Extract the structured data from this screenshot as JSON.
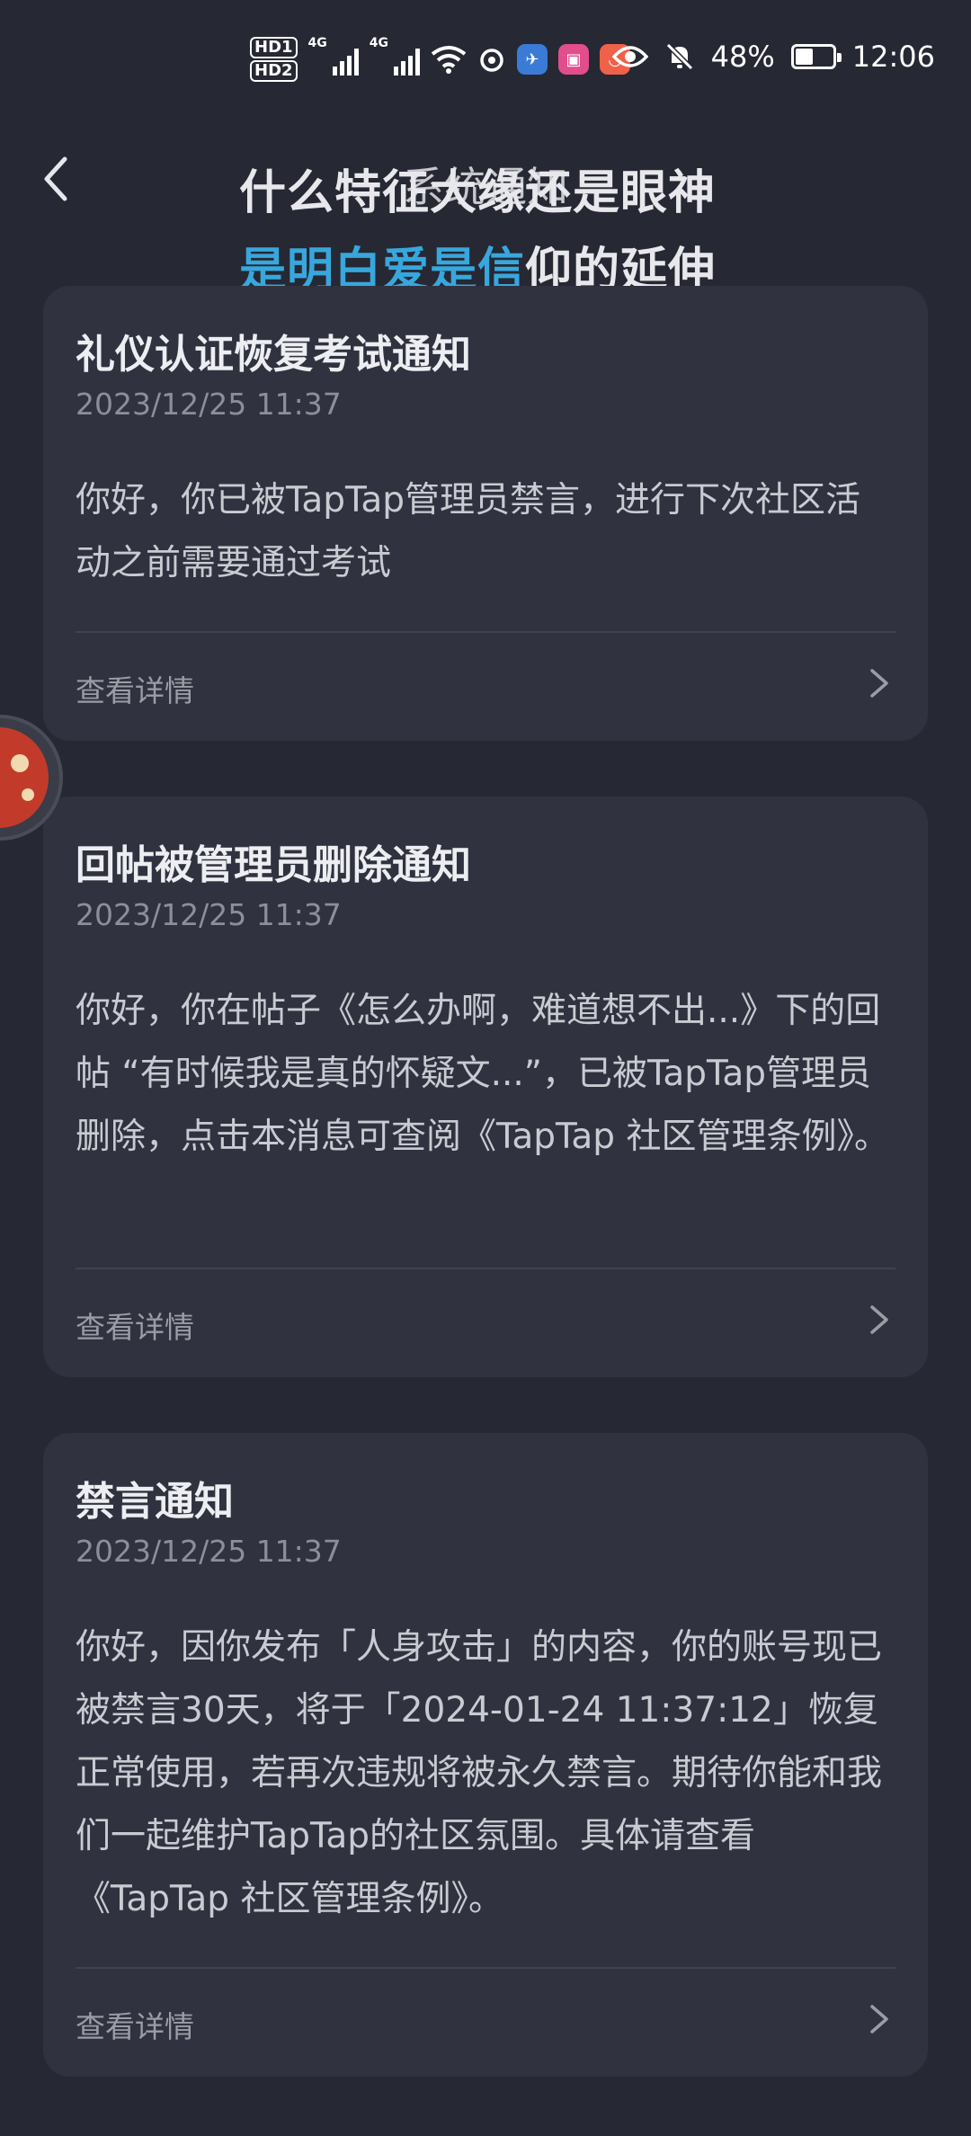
{
  "status_bar": {
    "hd1": "HD1",
    "hd2": "HD2",
    "net1": "4G",
    "net2": "4G",
    "battery": "48%",
    "time": "12:06",
    "battery_level": 0.48
  },
  "header": {
    "title": "系统通知",
    "lyric_line1": "什么特征大缘还是眼神",
    "lyric_line2_highlight": "是明白爱是信",
    "lyric_line2_rest": "仰的延伸"
  },
  "cards": [
    {
      "title": "礼仪认证恢复考试通知",
      "date": "2023/12/25 11:37",
      "body": "你好，你已被TapTap管理员禁言，进行下次社区活动之前需要通过考试",
      "detail": "查看详情"
    },
    {
      "title": "回帖被管理员删除通知",
      "date": "2023/12/25 11:37",
      "body": "你好，你在帖子《怎么办啊，难道想不出...》下的回帖 “有时候我是真的怀疑文...”，已被TapTap管理员删除，点击本消息可查阅《TapTap 社区管理条例》。",
      "detail": "查看详情"
    },
    {
      "title": "禁言通知",
      "date": "2023/12/25 11:37",
      "body": "你好，因你发布「人身攻击」的内容，你的账号现已被禁言30天，将于「2024-01-24 11:37:12」恢复正常使用，若再次违规将被永久禁言。期待你能和我们一起维护TapTap的社区氛围。具体请查看《TapTap 社区管理条例》。",
      "detail": "查看详情"
    }
  ],
  "colors": {
    "background": "#262833",
    "card": "#30323f",
    "lyric_highlight": "#37a7dd"
  }
}
